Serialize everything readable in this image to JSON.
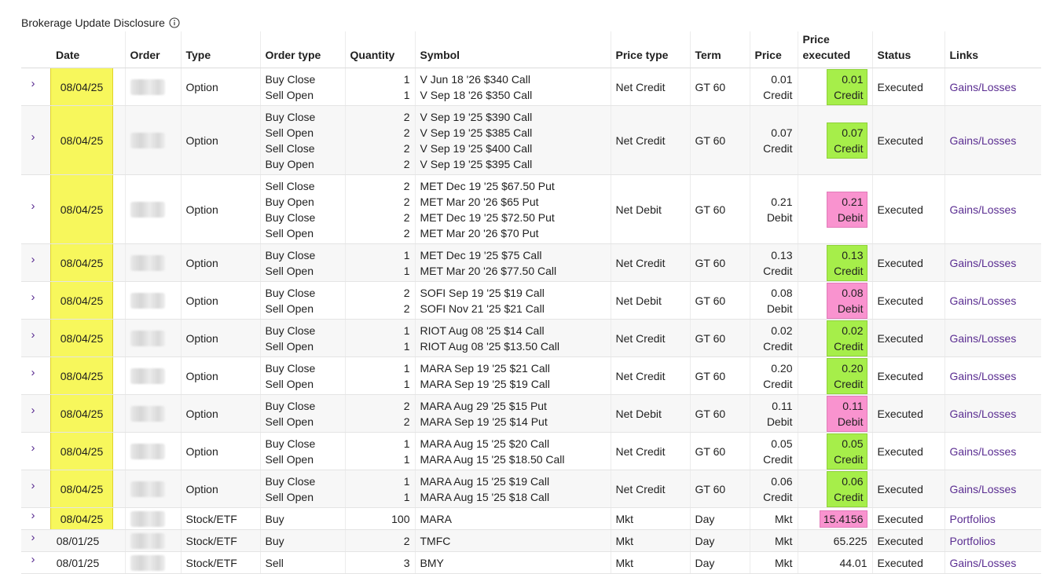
{
  "header": {
    "disclosure": "Brokerage Update Disclosure"
  },
  "columns": {
    "date": "Date",
    "order": "Order",
    "type": "Type",
    "order_type": "Order type",
    "quantity": "Quantity",
    "symbol": "Symbol",
    "price_type": "Price type",
    "term": "Term",
    "price": "Price",
    "price_executed_line1": "Price",
    "price_executed_line2": "executed",
    "status": "Status",
    "links": "Links"
  },
  "colors": {
    "date_highlight": "#f7f75c",
    "credit_highlight": "#a6ee4a",
    "debit_highlight": "#f993cf",
    "link": "#5a2d91"
  },
  "rows": [
    {
      "date": "08/04/25",
      "type": "Option",
      "order_types": [
        "Buy Close",
        "Sell Open"
      ],
      "quantities": [
        "1",
        "1"
      ],
      "symbols": [
        "V Jun 18 '26 $340 Call",
        "V Sep 18 '26 $350 Call"
      ],
      "price_type": "Net Credit",
      "term": "GT 60",
      "price": [
        "0.01",
        "Credit"
      ],
      "executed": [
        "0.01",
        "Credit"
      ],
      "hl": "credit",
      "status": "Executed",
      "link": "Gains/Losses"
    },
    {
      "date": "08/04/25",
      "type": "Option",
      "order_types": [
        "Buy Close",
        "Sell Open",
        "Sell Close",
        "Buy Open"
      ],
      "quantities": [
        "2",
        "2",
        "2",
        "2"
      ],
      "symbols": [
        "V Sep 19 '25 $390 Call",
        "V Sep 19 '25 $385 Call",
        "V Sep 19 '25 $400 Call",
        "V Sep 19 '25 $395 Call"
      ],
      "price_type": "Net Credit",
      "term": "GT 60",
      "price": [
        "0.07",
        "Credit"
      ],
      "executed": [
        "0.07",
        "Credit"
      ],
      "hl": "credit",
      "status": "Executed",
      "link": "Gains/Losses"
    },
    {
      "date": "08/04/25",
      "type": "Option",
      "order_types": [
        "Sell Close",
        "Buy Open",
        "Buy Close",
        "Sell Open"
      ],
      "quantities": [
        "2",
        "2",
        "2",
        "2"
      ],
      "symbols": [
        "MET Dec 19 '25 $67.50 Put",
        "MET Mar 20 '26 $65 Put",
        "MET Dec 19 '25 $72.50 Put",
        "MET Mar 20 '26 $70 Put"
      ],
      "price_type": "Net Debit",
      "term": "GT 60",
      "price": [
        "0.21",
        "Debit"
      ],
      "executed": [
        "0.21",
        "Debit"
      ],
      "hl": "debit",
      "status": "Executed",
      "link": "Gains/Losses"
    },
    {
      "date": "08/04/25",
      "type": "Option",
      "order_types": [
        "Buy Close",
        "Sell Open"
      ],
      "quantities": [
        "1",
        "1"
      ],
      "symbols": [
        "MET Dec 19 '25 $75 Call",
        "MET Mar 20 '26 $77.50 Call"
      ],
      "price_type": "Net Credit",
      "term": "GT 60",
      "price": [
        "0.13",
        "Credit"
      ],
      "executed": [
        "0.13",
        "Credit"
      ],
      "hl": "credit",
      "status": "Executed",
      "link": "Gains/Losses"
    },
    {
      "date": "08/04/25",
      "type": "Option",
      "order_types": [
        "Buy Close",
        "Sell Open"
      ],
      "quantities": [
        "2",
        "2"
      ],
      "symbols": [
        "SOFI Sep 19 '25 $19 Call",
        "SOFI Nov 21 '25 $21 Call"
      ],
      "price_type": "Net Debit",
      "term": "GT 60",
      "price": [
        "0.08",
        "Debit"
      ],
      "executed": [
        "0.08",
        "Debit"
      ],
      "hl": "debit",
      "status": "Executed",
      "link": "Gains/Losses"
    },
    {
      "date": "08/04/25",
      "type": "Option",
      "order_types": [
        "Buy Close",
        "Sell Open"
      ],
      "quantities": [
        "1",
        "1"
      ],
      "symbols": [
        "RIOT Aug 08 '25 $14 Call",
        "RIOT Aug 08 '25 $13.50 Call"
      ],
      "price_type": "Net Credit",
      "term": "GT 60",
      "price": [
        "0.02",
        "Credit"
      ],
      "executed": [
        "0.02",
        "Credit"
      ],
      "hl": "credit",
      "status": "Executed",
      "link": "Gains/Losses"
    },
    {
      "date": "08/04/25",
      "type": "Option",
      "order_types": [
        "Buy Close",
        "Sell Open"
      ],
      "quantities": [
        "1",
        "1"
      ],
      "symbols": [
        "MARA Sep 19 '25 $21 Call",
        "MARA Sep 19 '25 $19 Call"
      ],
      "price_type": "Net Credit",
      "term": "GT 60",
      "price": [
        "0.20",
        "Credit"
      ],
      "executed": [
        "0.20",
        "Credit"
      ],
      "hl": "credit",
      "status": "Executed",
      "link": "Gains/Losses"
    },
    {
      "date": "08/04/25",
      "type": "Option",
      "order_types": [
        "Buy Close",
        "Sell Open"
      ],
      "quantities": [
        "2",
        "2"
      ],
      "symbols": [
        "MARA Aug 29 '25 $15 Put",
        "MARA Sep 19 '25 $14 Put"
      ],
      "price_type": "Net Debit",
      "term": "GT 60",
      "price": [
        "0.11",
        "Debit"
      ],
      "executed": [
        "0.11",
        "Debit"
      ],
      "hl": "debit",
      "status": "Executed",
      "link": "Gains/Losses"
    },
    {
      "date": "08/04/25",
      "type": "Option",
      "order_types": [
        "Buy Close",
        "Sell Open"
      ],
      "quantities": [
        "1",
        "1"
      ],
      "symbols": [
        "MARA Aug 15 '25 $20 Call",
        "MARA Aug 15 '25 $18.50 Call"
      ],
      "price_type": "Net Credit",
      "term": "GT 60",
      "price": [
        "0.05",
        "Credit"
      ],
      "executed": [
        "0.05",
        "Credit"
      ],
      "hl": "credit",
      "status": "Executed",
      "link": "Gains/Losses"
    },
    {
      "date": "08/04/25",
      "type": "Option",
      "order_types": [
        "Buy Close",
        "Sell Open"
      ],
      "quantities": [
        "1",
        "1"
      ],
      "symbols": [
        "MARA Aug 15 '25 $19 Call",
        "MARA Aug 15 '25 $18 Call"
      ],
      "price_type": "Net Credit",
      "term": "GT 60",
      "price": [
        "0.06",
        "Credit"
      ],
      "executed": [
        "0.06",
        "Credit"
      ],
      "hl": "credit",
      "status": "Executed",
      "link": "Gains/Losses"
    },
    {
      "date": "08/04/25",
      "type": "Stock/ETF",
      "order_types": [
        "Buy"
      ],
      "quantities": [
        "100"
      ],
      "symbols": [
        "MARA"
      ],
      "price_type": "Mkt",
      "term": "Day",
      "price": [
        "Mkt"
      ],
      "executed": [
        "15.4156"
      ],
      "hl": "debit-strip",
      "status": "Executed",
      "link": "Portfolios"
    },
    {
      "date": "08/01/25",
      "type": "Stock/ETF",
      "order_types": [
        "Buy"
      ],
      "quantities": [
        "2"
      ],
      "symbols": [
        "TMFC"
      ],
      "price_type": "Mkt",
      "term": "Day",
      "price": [
        "Mkt"
      ],
      "executed": [
        "65.225"
      ],
      "hl": "none",
      "status": "Executed",
      "link": "Portfolios"
    },
    {
      "date": "08/01/25",
      "type": "Stock/ETF",
      "order_types": [
        "Sell"
      ],
      "quantities": [
        "3"
      ],
      "symbols": [
        "BMY"
      ],
      "price_type": "Mkt",
      "term": "Day",
      "price": [
        "Mkt"
      ],
      "executed": [
        "44.01"
      ],
      "hl": "none",
      "status": "Executed",
      "link": "Gains/Losses"
    }
  ]
}
